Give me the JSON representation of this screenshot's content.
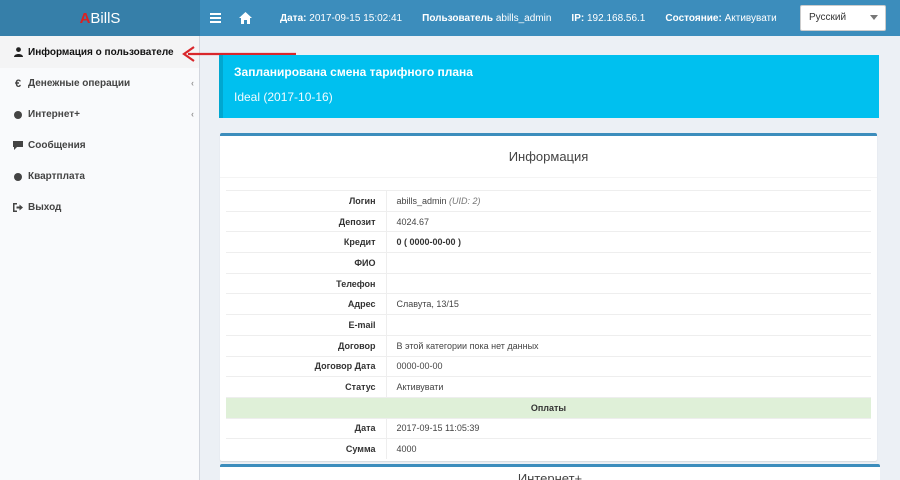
{
  "header": {
    "logo_a": "A",
    "logo_rest": "BillS",
    "date_label": "Дата:",
    "date_value": "2017-09-15 15:02:41",
    "user_label": "Пользователь",
    "user_value": "abills_admin",
    "ip_label": "IP:",
    "ip_value": "192.168.56.1",
    "state_label": "Состояние:",
    "state_value": "Активувати",
    "language": "Русский"
  },
  "sidebar": {
    "items": [
      {
        "icon": "user-icon",
        "label": "Информация о пользователе"
      },
      {
        "icon": "euro-icon",
        "label": "Денежные операции"
      },
      {
        "icon": "circle-icon",
        "label": "Интернет+"
      },
      {
        "icon": "comment-icon",
        "label": "Сообщения"
      },
      {
        "icon": "circle-icon",
        "label": "Квартплата"
      },
      {
        "icon": "sign-out-icon",
        "label": "Выход"
      }
    ]
  },
  "callout": {
    "title": "Запланирована смена тарифного плана",
    "subtitle": "Ideal (2017-10-16)"
  },
  "info": {
    "title": "Информация",
    "rows": [
      {
        "key": "Логин",
        "value": "abills_admin",
        "extra": "(UID: 2)"
      },
      {
        "key": "Депозит",
        "value": "4024.67"
      },
      {
        "key": "Кредит",
        "value": "0 ( 0000-00-00 )"
      },
      {
        "key": "ФИО",
        "value": ""
      },
      {
        "key": "Телефон",
        "value": ""
      },
      {
        "key": "Адрес",
        "value": "Славута, 13/15"
      },
      {
        "key": "E-mail",
        "value": ""
      },
      {
        "key": "Договор",
        "value": "В этой категории пока нет данных"
      },
      {
        "key": "Договор Дата",
        "value": "0000-00-00"
      },
      {
        "key": "Статус",
        "value": "Активувати"
      }
    ],
    "payments_header": "Оплаты",
    "payment_rows": [
      {
        "key": "Дата",
        "value": "2017-09-15 11:05:39"
      },
      {
        "key": "Сумма",
        "value": "4000"
      }
    ]
  },
  "next_box": {
    "title": "Интернет+"
  },
  "colors": {
    "header": "#3c8dbc",
    "logo_bg": "#367fa9",
    "callout": "#00c0ef",
    "section_bg": "#dff0d8",
    "arrow": "#d9262b"
  }
}
